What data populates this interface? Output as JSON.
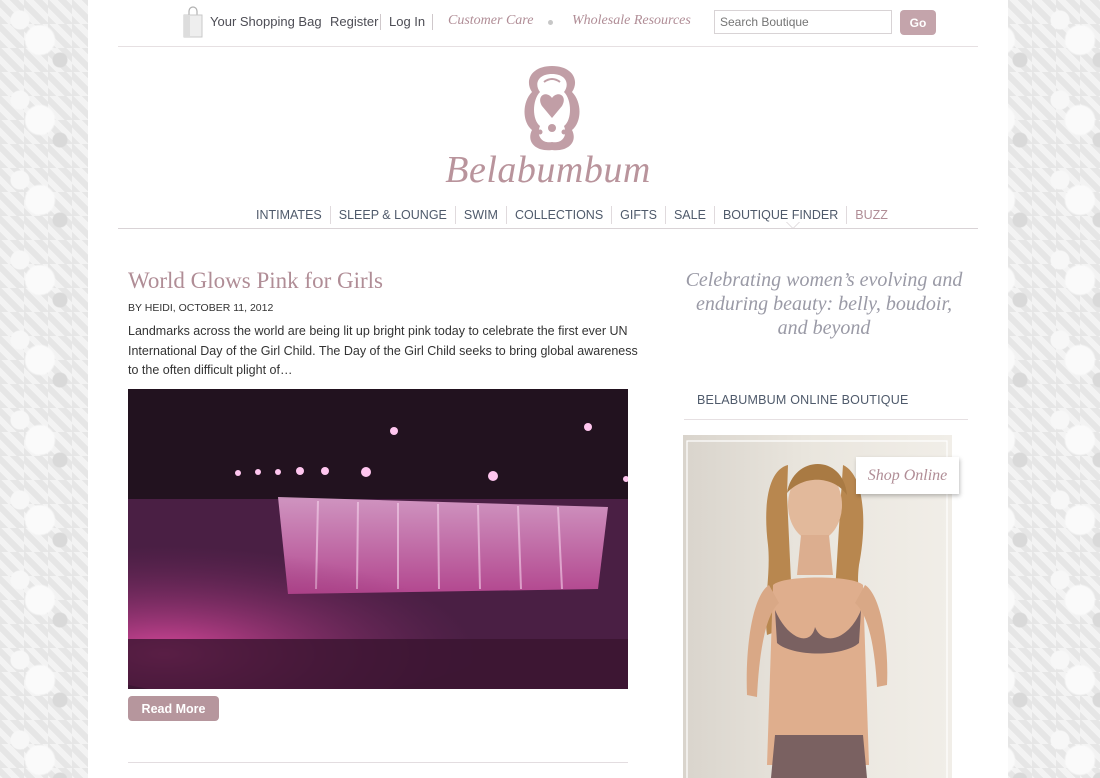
{
  "topbar": {
    "shopping_bag": "Your Shopping Bag",
    "register": "Register",
    "login": "Log In",
    "customer_care": "Customer Care",
    "wholesale": "Wholesale Resources",
    "search_placeholder": "Search Boutique",
    "go": "Go"
  },
  "brand": {
    "name": "Belabumbum"
  },
  "nav": {
    "items": [
      "INTIMATES",
      "SLEEP & LOUNGE",
      "SWIM",
      "COLLECTIONS",
      "GIFTS",
      "SALE",
      "BOUTIQUE FINDER",
      "BUZZ"
    ],
    "active": "BUZZ"
  },
  "post": {
    "title": "World Glows Pink for Girls",
    "meta": "BY HEIDI, OCTOBER 11, 2012",
    "excerpt": "Landmarks across the world are being lit up bright pink today to celebrate the first ever UN International Day of the Girl Child. The Day of the Girl Child  seeks to bring global awareness to the often difficult plight of…",
    "read_more": "Read More"
  },
  "sidebar": {
    "tagline": "Celebrating women’s evolving and enduring beauty: belly, boudoir, and beyond",
    "heading": "BELABUMBUM ONLINE BOUTIQUE",
    "shop_online": "Shop Online"
  },
  "colors": {
    "brand_pink": "#b08d96",
    "button_pink": "#c4a4ab",
    "nav_text": "#4f5a6b",
    "tagline": "#9a9aa6"
  }
}
